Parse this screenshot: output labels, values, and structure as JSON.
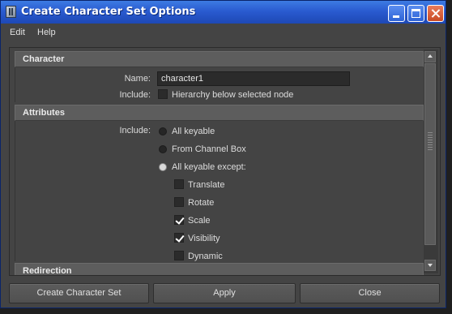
{
  "window": {
    "title": "Create Character Set Options",
    "controls": [
      "minimize-icon",
      "maximize-icon",
      "close-icon"
    ]
  },
  "menubar": {
    "edit": "Edit",
    "help": "Help"
  },
  "character_section": {
    "header": "Character",
    "name_label": "Name:",
    "name_value": "character1",
    "include_label": "Include:",
    "hierarchy_label": "Hierarchy below selected node",
    "hierarchy_checked": false
  },
  "attributes_section": {
    "header": "Attributes",
    "include_label": "Include:",
    "radios": [
      {
        "label": "All keyable",
        "selected": false
      },
      {
        "label": "From Channel Box",
        "selected": false
      },
      {
        "label": "All keyable except:",
        "selected": true
      }
    ],
    "checks": [
      {
        "label": "Translate",
        "checked": false
      },
      {
        "label": "Rotate",
        "checked": false
      },
      {
        "label": "Scale",
        "checked": true
      },
      {
        "label": "Visibility",
        "checked": true
      },
      {
        "label": "Dynamic",
        "checked": false
      }
    ]
  },
  "redirection_section": {
    "header": "Redirection"
  },
  "buttons": {
    "create": "Create Character Set",
    "apply": "Apply",
    "close": "Close"
  }
}
